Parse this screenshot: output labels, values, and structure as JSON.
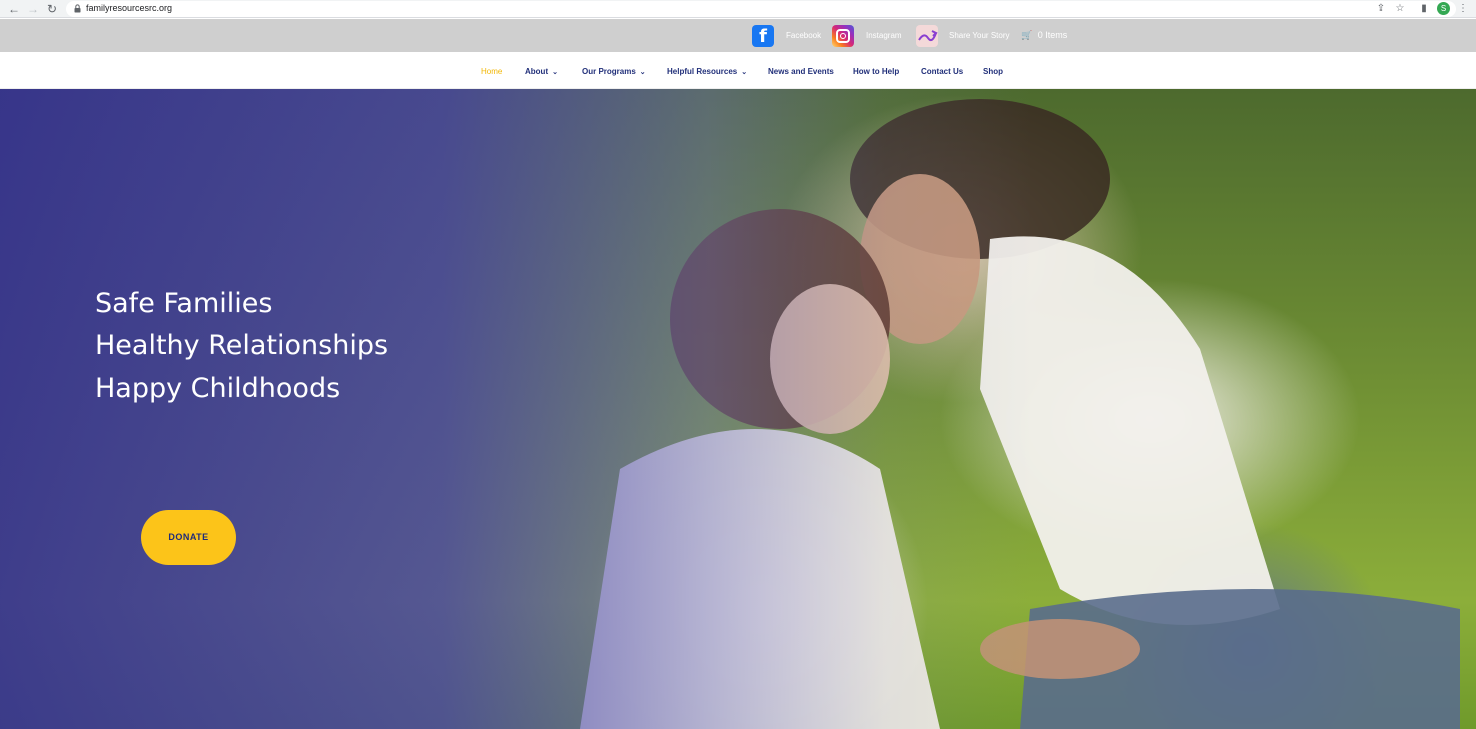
{
  "browser": {
    "url": "familyresourcesrc.org",
    "profile_initial": "S"
  },
  "topbar": {
    "facebook_label": "Facebook",
    "instagram_label": "Instagram",
    "story_label": "Share Your Story",
    "cart_label": "0 Items"
  },
  "nav": {
    "items": [
      {
        "label": "Home",
        "active": true
      },
      {
        "label": "About",
        "dropdown": true
      },
      {
        "label": "Our Programs",
        "dropdown": true
      },
      {
        "label": "Helpful Resources",
        "dropdown": true
      },
      {
        "label": "News and Events"
      },
      {
        "label": "How to Help"
      },
      {
        "label": "Contact Us"
      },
      {
        "label": "Shop"
      }
    ]
  },
  "hero": {
    "line1": "Safe Families",
    "line2": "Healthy Relationships",
    "line3": "Happy Childhoods",
    "donate_label": "DONATE"
  },
  "colors": {
    "accent": "#fcc419",
    "nav_text": "#22307a",
    "nav_active": "#f2b705",
    "overlay": "#342e96"
  }
}
